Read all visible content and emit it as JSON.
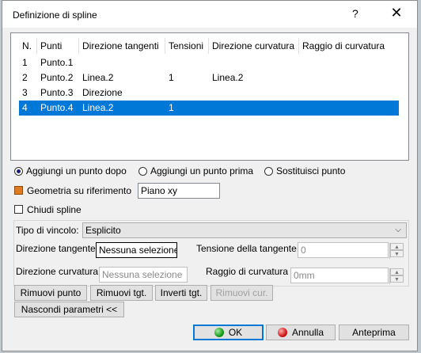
{
  "dialog": {
    "title": "Definizione di spline",
    "help": "?",
    "close": "✕"
  },
  "table": {
    "headers": [
      "N.",
      "Punti",
      "Direzione tangenti",
      "Tensioni",
      "Direzione curvatura",
      "Raggio di curvatura"
    ],
    "rows": [
      [
        "1",
        "Punto.1",
        "",
        "",
        "",
        ""
      ],
      [
        "2",
        "Punto.2",
        "Linea.2",
        "1",
        "Linea.2",
        ""
      ],
      [
        "3",
        "Punto.3",
        "Direzione",
        "",
        "",
        ""
      ],
      [
        "4",
        "Punto.4",
        "Linea.2",
        "1",
        "",
        ""
      ]
    ],
    "selected_row": 4
  },
  "insert_mode": {
    "options": [
      "Aggiungi un punto dopo",
      "Aggiungi un punto prima",
      "Sostituisci punto"
    ],
    "selected": "Aggiungi un punto dopo"
  },
  "geometry": {
    "label": "Geometria su riferimento",
    "checked": true,
    "value": "Piano xy"
  },
  "close_spline": {
    "label": "Chiudi spline",
    "checked": false
  },
  "constraint": {
    "type_label": "Tipo di vincolo:",
    "type_value": "Esplicito",
    "tangent_dir_label": "Direzione tangente",
    "tangent_dir_value": "Nessuna selezione",
    "tangent_tension_label": "Tensione della tangente",
    "tangent_tension_value": "0",
    "curv_dir_label": "Direzione curvatura",
    "curv_dir_value": "Nessuna selezione",
    "curv_radius_label": "Raggio di curvatura",
    "curv_radius_value": "0mm"
  },
  "action_buttons": {
    "remove_point": "Rimuovi punto",
    "remove_tgt": "Rimuovi tgt.",
    "invert_tgt": "Inverti tgt.",
    "remove_cur": "Rimuovi cur.",
    "hide_params": "Nascondi parametri <<"
  },
  "footer": {
    "ok": "OK",
    "cancel": "Annulla",
    "preview": "Anteprima"
  }
}
